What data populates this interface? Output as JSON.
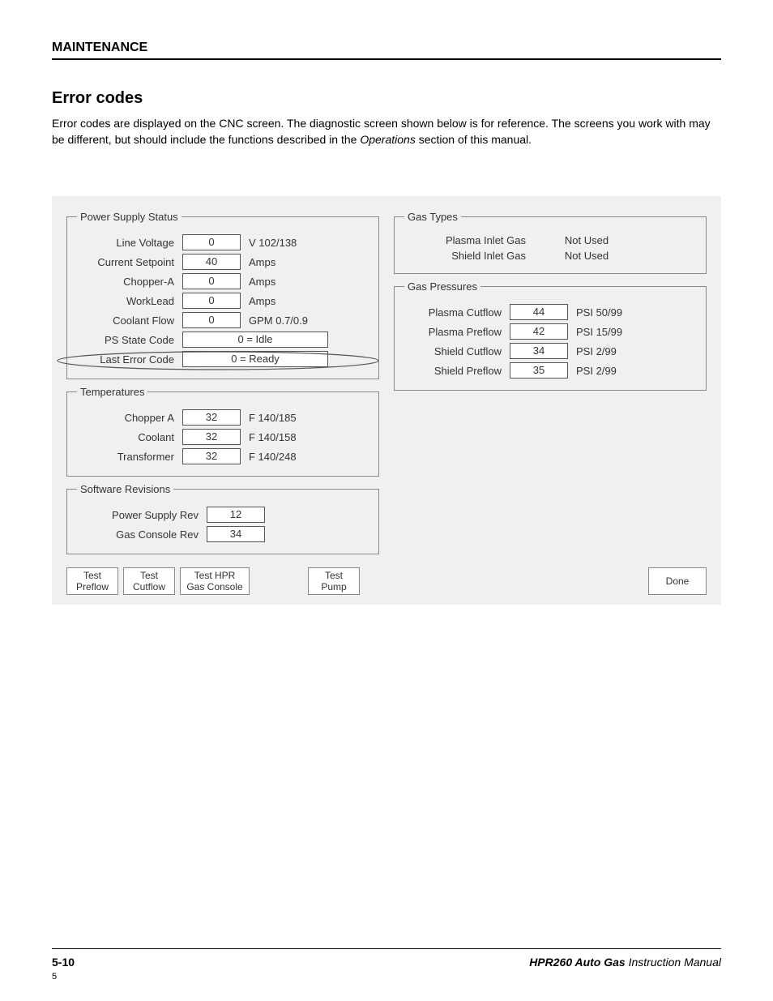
{
  "header": {
    "section": "MAINTENANCE"
  },
  "title": "Error codes",
  "intro": {
    "text1": "Error codes are displayed on the CNC screen. The diagnostic screen shown below is for reference. The screens you work with may be different, but should include the functions described in the ",
    "italic": "Operations",
    "text2": " section of this manual."
  },
  "pss": {
    "legend": "Power Supply Status",
    "lineVoltage": {
      "label": "Line Voltage",
      "value": "0",
      "unit": "V 102/138"
    },
    "currentSetpoint": {
      "label": "Current Setpoint",
      "value": "40",
      "unit": "Amps"
    },
    "chopperA": {
      "label": "Chopper-A",
      "value": "0",
      "unit": "Amps"
    },
    "workLead": {
      "label": "WorkLead",
      "value": "0",
      "unit": "Amps"
    },
    "coolantFlow": {
      "label": "Coolant Flow",
      "value": "0",
      "unit": "GPM 0.7/0.9"
    },
    "psState": {
      "label": "PS State Code",
      "value": "0 = Idle"
    },
    "lastError": {
      "label": "Last Error Code",
      "value": "0 = Ready"
    }
  },
  "temps": {
    "legend": "Temperatures",
    "chopperA": {
      "label": "Chopper A",
      "value": "32",
      "unit": "F 140/185"
    },
    "coolant": {
      "label": "Coolant",
      "value": "32",
      "unit": "F 140/158"
    },
    "transformer": {
      "label": "Transformer",
      "value": "32",
      "unit": "F 140/248"
    }
  },
  "sw": {
    "legend": "Software Revisions",
    "ps": {
      "label": "Power Supply Rev",
      "value": "12"
    },
    "gc": {
      "label": "Gas Console Rev",
      "value": "34"
    }
  },
  "gasTypes": {
    "legend": "Gas Types",
    "plasma": {
      "label": "Plasma Inlet Gas",
      "value": "Not Used"
    },
    "shield": {
      "label": "Shield Inlet Gas",
      "value": "Not Used"
    }
  },
  "gasPress": {
    "legend": "Gas Pressures",
    "plasmaCut": {
      "label": "Plasma Cutflow",
      "value": "44",
      "unit": "PSI 50/99"
    },
    "plasmaPre": {
      "label": "Plasma Preflow",
      "value": "42",
      "unit": "PSI 15/99"
    },
    "shieldCut": {
      "label": "Shield Cutflow",
      "value": "34",
      "unit": "PSI 2/99"
    },
    "shieldPre": {
      "label": "Shield Preflow",
      "value": "35",
      "unit": "PSI 2/99"
    }
  },
  "buttons": {
    "testPreflow": "Test\nPreflow",
    "testCutflow": "Test\nCutflow",
    "testHpr": "Test HPR\nGas Console",
    "testPump": "Test\nPump",
    "done": "Done"
  },
  "footer": {
    "page": "5-10",
    "manualBold": "HPR260 Auto Gas",
    "manualRest": " Instruction Manual",
    "small": "5"
  }
}
